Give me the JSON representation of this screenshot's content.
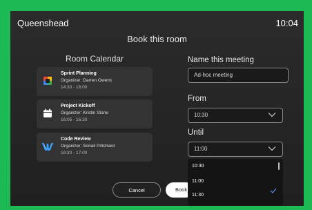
{
  "header": {
    "room_name": "Queenshead",
    "time": "10:04",
    "title": "Book this room"
  },
  "calendar": {
    "heading": "Room Calendar",
    "meetings": [
      {
        "title": "Sprint Planning",
        "organizer": "Organizer: Darren Owens",
        "time": "14:30 - 16:00",
        "icon": "teams-icon"
      },
      {
        "title": "Project Kickoff",
        "organizer": "Organizer: Kristin Stone",
        "time": "16:05 - 16:30",
        "icon": "calendar-icon"
      },
      {
        "title": "Code Review",
        "organizer": "Organizer: Sonali Pritchard",
        "time": "16:30 - 17:00",
        "icon": "webex-icon"
      }
    ]
  },
  "form": {
    "name_label": "Name this meeting",
    "name_value": "Ad-hoc meeting",
    "from_label": "From",
    "from_value": "10:30",
    "until_label": "Until",
    "until_value": "11:00",
    "until_options": [
      {
        "label": "10:30",
        "selected": false
      },
      {
        "label": "11:00",
        "selected": true
      },
      {
        "label": "11:30",
        "selected": false
      }
    ]
  },
  "buttons": {
    "cancel": "Cancel",
    "book": "Book"
  },
  "colors": {
    "frame": "#1db954",
    "check": "#5b8ef7",
    "teams_red": "#e8453c",
    "teams_green": "#34a853",
    "teams_blue": "#4285f4",
    "teams_yellow": "#fbbc05",
    "webex_blue": "#3aa0ff",
    "webex_cyan": "#6fd3ff"
  }
}
